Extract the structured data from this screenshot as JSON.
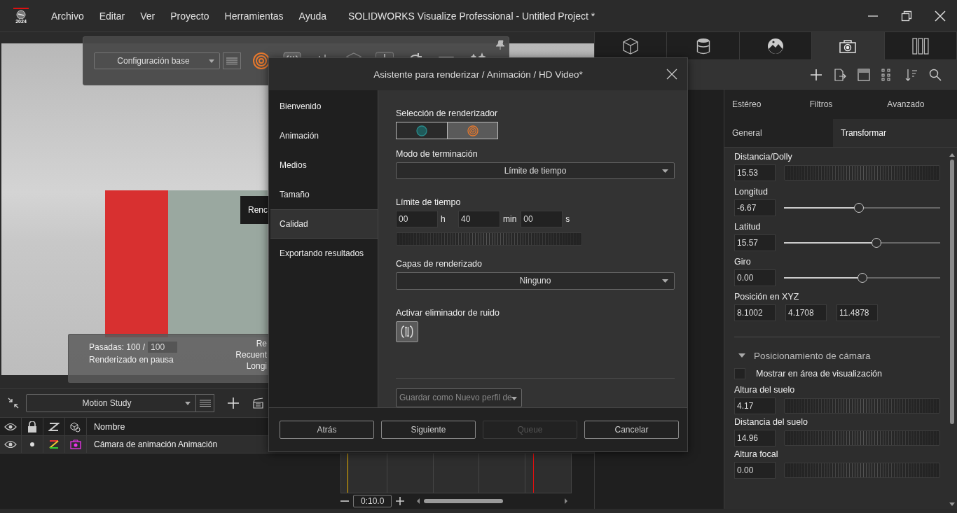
{
  "app": {
    "logo_year": "2024",
    "menu": [
      "Archivo",
      "Editar",
      "Ver",
      "Proyecto",
      "Herramientas",
      "Ayuda"
    ],
    "title": "SOLIDWORKS Visualize Professional - Untitled Project *"
  },
  "viewport": {
    "toolbar": {
      "config": "Configuración base"
    },
    "tooltip": "Renc",
    "stats": {
      "passes_label": "Pasadas: 100 /",
      "passes_max": "100",
      "status": "Renderizado en pausa",
      "right": [
        "Re",
        "Recuent",
        "Longi"
      ]
    }
  },
  "motion": {
    "study": "Motion Study",
    "header": "Nombre",
    "rows": [
      {
        "name": "Cámara de animación Animación"
      }
    ],
    "timeline": {
      "time": "0:10.0"
    }
  },
  "dialog": {
    "title": "Asistente para renderizar / Animación / HD Video*",
    "steps": [
      {
        "label": "Bienvenido",
        "selected": false
      },
      {
        "label": "Animación",
        "selected": false
      },
      {
        "label": "Medios",
        "selected": false
      },
      {
        "label": "Tamaño",
        "selected": false
      },
      {
        "label": "Calidad",
        "selected": true
      },
      {
        "label": "Exportando resultados",
        "selected": false
      }
    ],
    "renderer": {
      "label": "Selección de renderizador",
      "options": [
        {
          "kind": "fast",
          "selected": false
        },
        {
          "kind": "accurate",
          "selected": true
        }
      ]
    },
    "termination": {
      "label": "Modo de terminación",
      "value": "Límite de tiempo"
    },
    "time_limit": {
      "label": "Límite de tiempo",
      "fields": [
        {
          "value": "00",
          "unit": "h"
        },
        {
          "value": "40",
          "unit": "min"
        },
        {
          "value": "00",
          "unit": "s"
        }
      ]
    },
    "layers": {
      "label": "Capas de renderizado",
      "value": "Ninguno"
    },
    "denoiser": {
      "label": "Activar eliminador de ruido",
      "on": true
    },
    "profile": {
      "value": "Guardar como Nuevo perfil de"
    },
    "buttons": [
      {
        "label": "Atrás",
        "disabled": false
      },
      {
        "label": "Siguiente",
        "disabled": false
      },
      {
        "label": "Queue",
        "disabled": true
      },
      {
        "label": "Cancelar",
        "disabled": false
      }
    ]
  },
  "right_panel": {
    "tabs": [
      {
        "kind": "model",
        "selected": false
      },
      {
        "kind": "appearance",
        "selected": false
      },
      {
        "kind": "environment",
        "selected": false
      },
      {
        "kind": "camera",
        "selected": true
      },
      {
        "kind": "libraries",
        "selected": false
      }
    ],
    "subtabs_top": [
      {
        "label": "Estéreo",
        "selected": false
      },
      {
        "label": "Filtros",
        "selected": false
      },
      {
        "label": "Avanzado",
        "selected": false
      }
    ],
    "subtabs_bottom": [
      {
        "label": "General",
        "selected": false
      },
      {
        "label": "Transformar",
        "selected": true
      }
    ],
    "properties": [
      {
        "kind": "jog",
        "label": "Distancia/Dolly",
        "value": "15.53"
      },
      {
        "kind": "slider",
        "label": "Longitud",
        "value": "-6.67",
        "level": 0.48
      },
      {
        "kind": "slider",
        "label": "Latitud",
        "value": "15.57",
        "level": 0.59
      },
      {
        "kind": "slider",
        "label": "Giro",
        "value": "0.00",
        "level": 0.5
      },
      {
        "kind": "xyz",
        "label": "Posición en XYZ",
        "values": [
          "8.1002",
          "4.1708",
          "11.4878"
        ]
      }
    ],
    "section": {
      "title": "Posicionamiento de cámara",
      "expanded": true,
      "show": {
        "label": "Mostrar en área de visualización",
        "checked": false
      },
      "properties": [
        {
          "kind": "jog",
          "label": "Altura del suelo",
          "value": "4.17"
        },
        {
          "kind": "jog",
          "label": "Distancia del suelo",
          "value": "14.96"
        },
        {
          "kind": "jog",
          "label": "Altura focal",
          "value": "0.00"
        }
      ]
    }
  }
}
